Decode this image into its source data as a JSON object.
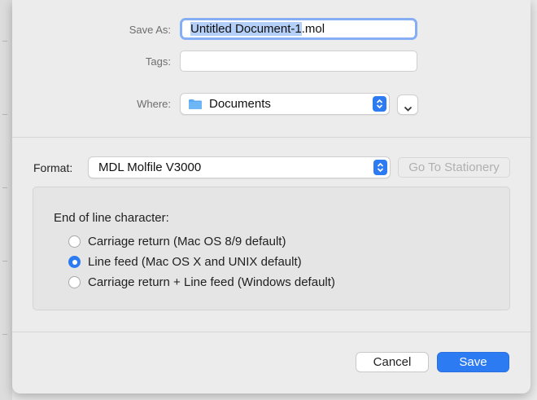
{
  "save_panel": {
    "save_as_label": "Save As:",
    "filename_selected": "Untitled Document-1",
    "filename_ext": ".mol",
    "tags_label": "Tags:",
    "tags_value": "",
    "where_label": "Where:",
    "where_value": "Documents",
    "where_icon": "folder-icon"
  },
  "format": {
    "label": "Format:",
    "value": "MDL Molfile V3000",
    "stationery_button": "Go To Stationery"
  },
  "eol_options": {
    "title": "End of line character:",
    "options": [
      {
        "label": "Carriage return (Mac OS 8/9 default)",
        "selected": false
      },
      {
        "label": "Line feed (Mac OS X and UNIX default)",
        "selected": true
      },
      {
        "label": "Carriage return + Line feed (Windows default)",
        "selected": false
      }
    ]
  },
  "buttons": {
    "cancel": "Cancel",
    "save": "Save"
  },
  "colors": {
    "accent": "#2d7bf3",
    "focus_ring": "#85aef5",
    "selection": "#b4cff8"
  }
}
